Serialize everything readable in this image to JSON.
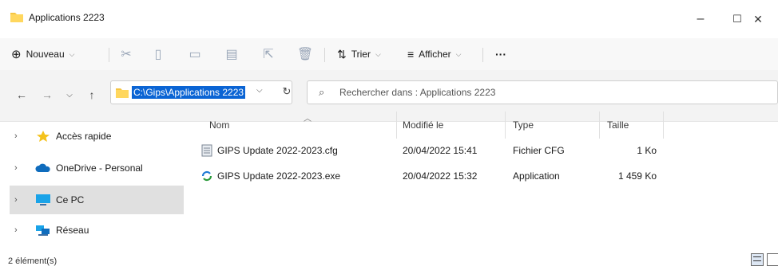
{
  "window": {
    "title": "Applications 2223",
    "controls": [
      "–",
      "☐",
      "✕"
    ]
  },
  "commandbar": {
    "new_label": "Nouveau",
    "sort_label": "Trier",
    "view_label": "Afficher",
    "more_label": "···"
  },
  "address": {
    "path": "C:\\Gips\\Applications 2223",
    "search_placeholder": "Rechercher dans : Applications 2223"
  },
  "sidebar": {
    "items": [
      {
        "label": "Accès rapide",
        "icon": "star-icon",
        "color": "#f4c21b"
      },
      {
        "label": "OneDrive - Personal",
        "icon": "cloud-icon",
        "color": "#0f6cbd"
      },
      {
        "label": "Ce PC",
        "icon": "pc-icon",
        "color": "#1aa3e8"
      },
      {
        "label": "Réseau",
        "icon": "network-icon",
        "color": "#1aa3e8"
      }
    ]
  },
  "table": {
    "columns": [
      "Nom",
      "Modifié le",
      "Type",
      "Taille"
    ],
    "rows": [
      {
        "name": "GIPS Update 2022-2023.cfg",
        "modified": "20/04/2022 15:41",
        "type": "Fichier CFG",
        "size": "1 Ko"
      },
      {
        "name": "GIPS Update 2022-2023.exe",
        "modified": "20/04/2022 15:32",
        "type": "Application",
        "size": "1 459 Ko"
      }
    ]
  },
  "status": {
    "count": "2 élément(s)"
  },
  "colors": {
    "selection": "#0a64d4",
    "folder": "#f5c542"
  }
}
